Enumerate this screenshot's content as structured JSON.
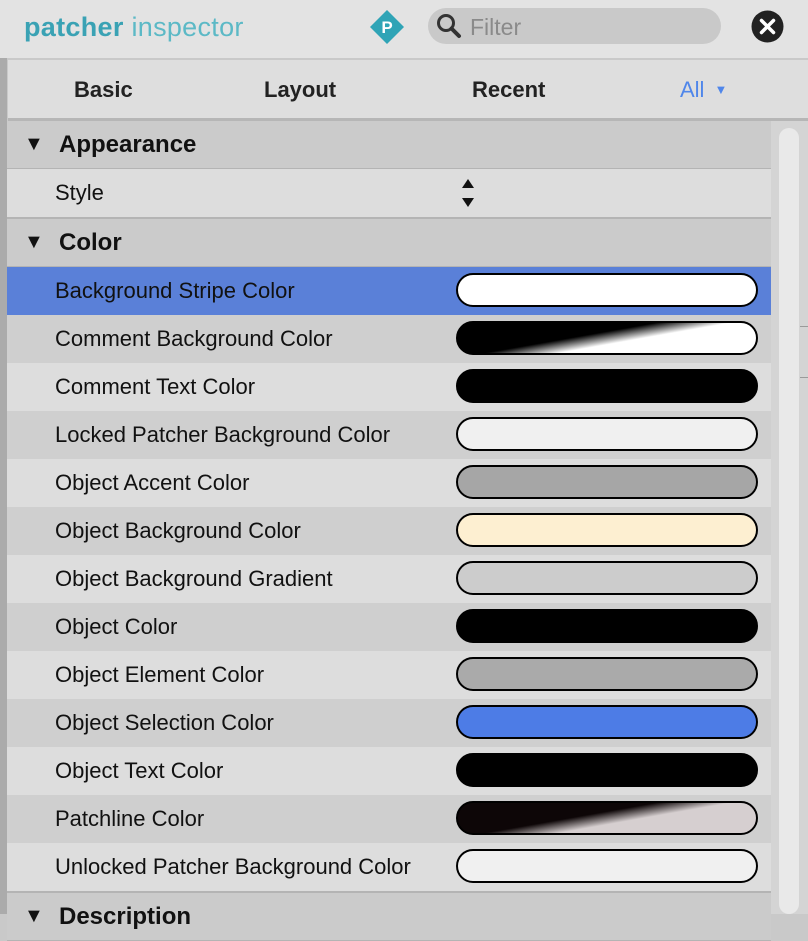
{
  "title": {
    "bold": "patcher",
    "rest": "inspector"
  },
  "filter": {
    "placeholder": "Filter",
    "value": ""
  },
  "tabs": [
    {
      "label": "Basic"
    },
    {
      "label": "Layout"
    },
    {
      "label": "Recent"
    },
    {
      "label": "All",
      "active": true
    }
  ],
  "sections": {
    "appearance": {
      "title": "Appearance",
      "rows": [
        {
          "label": "Style"
        }
      ]
    },
    "color": {
      "title": "Color",
      "rows": [
        {
          "label": "Background Stripe Color",
          "swatch": "#ffffff",
          "selected": true
        },
        {
          "label": "Comment Background Color",
          "swatch": "gradient:#000000-#ffffff"
        },
        {
          "label": "Comment Text Color",
          "swatch": "#000000"
        },
        {
          "label": "Locked Patcher Background Color",
          "swatch": "#f0f0f0"
        },
        {
          "label": "Object Accent Color",
          "swatch": "#a6a6a6"
        },
        {
          "label": "Object Background Color",
          "swatch": "#fdefd1"
        },
        {
          "label": "Object Background Gradient",
          "swatch": "#cccccc"
        },
        {
          "label": "Object Color",
          "swatch": "#000000"
        },
        {
          "label": "Object Element Color",
          "swatch": "#aaaaaa"
        },
        {
          "label": "Object Selection Color",
          "swatch": "#4d7ce6"
        },
        {
          "label": "Object Text Color",
          "swatch": "#000000"
        },
        {
          "label": "Patchline Color",
          "swatch": "gradient:#0d0607-#d6cfd0"
        },
        {
          "label": "Unlocked Patcher Background Color",
          "swatch": "#f0f0f0"
        }
      ]
    },
    "description": {
      "title": "Description"
    }
  },
  "colors": {
    "accent": "#4f86ea",
    "brand": "#3aa2b4",
    "selected_row": "#5a80d8"
  },
  "icons": {
    "app": "p-diamond-icon",
    "search": "search-icon",
    "close": "close-icon",
    "disclosure": "disclosure-triangle-icon",
    "stepper": "up-down-stepper-icon"
  }
}
